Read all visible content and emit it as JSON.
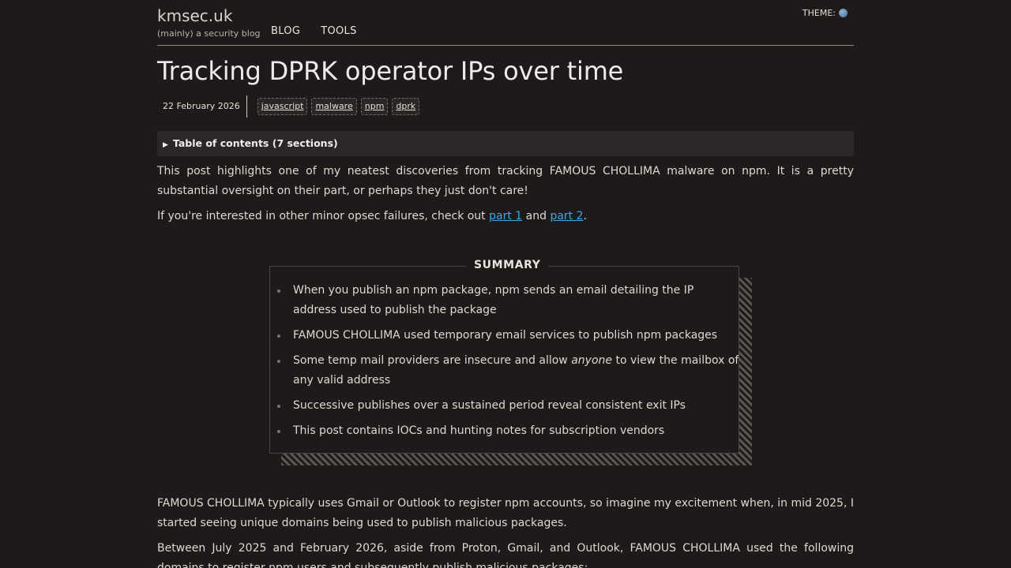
{
  "header": {
    "brand_title": "kmsec.uk",
    "brand_subtitle": "(mainly) a security blog",
    "nav": [
      {
        "label": "BLOG"
      },
      {
        "label": "TOOLS"
      }
    ],
    "theme_label": "THEME:",
    "theme_icon": "globe-icon"
  },
  "post": {
    "title": "Tracking DPRK operator IPs over time",
    "date": "22 February 2026",
    "tags": [
      "javascript",
      "malware",
      "npm",
      "dprk"
    ],
    "toc_label": "Table of contents (7 sections)",
    "intro": "This post highlights one of my neatest discoveries from tracking FAMOUS CHOLLIMA malware on npm. It is a pretty substantial oversight on their part, or perhaps they just don't care!",
    "links_prefix": "If you're interested in other minor opsec failures, check out ",
    "link1": "part 1",
    "links_and": " and ",
    "link2": "part 2",
    "links_suffix": ".",
    "summary": {
      "title": "SUMMARY",
      "items": [
        "When you publish an npm package, npm sends an email detailing the IP address used to publish the package",
        "FAMOUS CHOLLIMA used temporary email services to publish npm packages",
        {
          "before": "Some temp mail providers are insecure and allow ",
          "em": "anyone",
          "after": " to view the mailbox of any valid address"
        },
        "Successive publishes over a sustained period reveal consistent exit IPs",
        "This post contains IOCs and hunting notes for subscription vendors"
      ]
    },
    "body_p1": "FAMOUS CHOLLIMA typically uses Gmail or Outlook to register npm accounts, so imagine my excitement when, in mid 2025, I started seeing unique domains being used to publish malicious packages.",
    "body_p2": "Between July 2025 and February 2026, aside from Proton, Gmail, and Outlook, FAMOUS CHOLLIMA used the following domains to register npm users and subsequently publish malicious packages:"
  },
  "colors": {
    "background": "#1d1a19",
    "text": "#dcdad7",
    "link": "#3fa7e8"
  }
}
